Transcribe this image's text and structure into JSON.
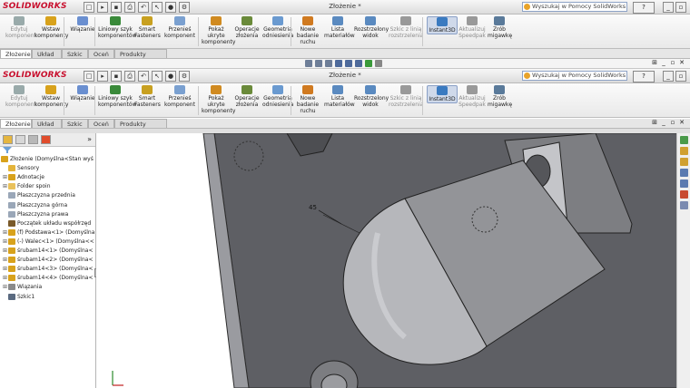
{
  "app": {
    "logo": "SOLIDWORKS",
    "document_title": "Złożenie *",
    "search_placeholder": "Wyszukaj w Pomocy SolidWorks",
    "help_label": "?"
  },
  "ribbon": {
    "buttons": [
      {
        "label": "Edytuj komponent",
        "icon": "edit-component-icon",
        "dim": true
      },
      {
        "label": "Wstaw komponenty",
        "icon": "insert-components-icon"
      },
      {
        "label": "Wiązanie",
        "icon": "mate-icon"
      },
      {
        "label": "Liniowy szyk komponentów",
        "icon": "linear-pattern-icon"
      },
      {
        "label": "Smart Fasteners",
        "icon": "smart-fasteners-icon"
      },
      {
        "label": "Przenieś komponent",
        "icon": "move-component-icon"
      },
      {
        "label": "Pokaż ukryte komponenty",
        "icon": "show-hidden-icon"
      },
      {
        "label": "Operacje złożenia",
        "icon": "assembly-features-icon"
      },
      {
        "label": "Geometria odniesienia",
        "icon": "reference-geometry-icon"
      },
      {
        "label": "Nowe badanie ruchu",
        "icon": "motion-study-icon"
      },
      {
        "label": "Lista materiałów",
        "icon": "bom-icon"
      },
      {
        "label": "Rozstrzelony widok",
        "icon": "exploded-view-icon"
      },
      {
        "label": "Szkic z linią rozstrzelenia",
        "icon": "explode-line-sketch-icon",
        "dim": true
      },
      {
        "label": "Instant3D",
        "icon": "instant3d-icon",
        "active": true
      },
      {
        "label": "Aktualizuj Speedpak",
        "icon": "speedpak-icon",
        "dim": true
      },
      {
        "label": "Zrób migawkę",
        "icon": "snapshot-icon"
      }
    ]
  },
  "tabs": [
    "Złożenie",
    "Układ",
    "Szkic",
    "Oceń",
    "Produkty Office"
  ],
  "tree": {
    "filter_icon": "funnel-icon",
    "items": [
      {
        "label": "Złożenie  (Domyślna<Stan wyś",
        "icon": "assembly-icon",
        "color": "#d8a21c"
      },
      {
        "label": "Sensory",
        "icon": "sensor-icon",
        "color": "#e4b43a"
      },
      {
        "label": "Adnotacje",
        "icon": "annotations-icon",
        "color": "#d8a21c",
        "plus": true
      },
      {
        "label": "Folder spoin",
        "icon": "weld-folder-icon",
        "color": "#e9c15b",
        "plus": true
      },
      {
        "label": "Płaszczyzna przednia",
        "icon": "plane-icon",
        "color": "#9aa7b8"
      },
      {
        "label": "Płaszczyzna górna",
        "icon": "plane-icon",
        "color": "#9aa7b8"
      },
      {
        "label": "Płaszczyzna prawa",
        "icon": "plane-icon",
        "color": "#9aa7b8"
      },
      {
        "label": "Początek układu współrzęd",
        "icon": "origin-icon",
        "color": "#7a5a2a"
      },
      {
        "label": "(f) Podstawa<1> (Domyślna",
        "icon": "part-icon",
        "color": "#d8a21c",
        "plus": true
      },
      {
        "label": "(-) Walec<1> (Domyślna<<",
        "icon": "part-icon",
        "color": "#d8a21c",
        "plus": true
      },
      {
        "label": "śrubam14<1> (Domyślna<",
        "icon": "part-icon",
        "color": "#d8a21c",
        "plus": true
      },
      {
        "label": "śrubam14<2> (Domyślna<",
        "icon": "part-icon",
        "color": "#d8a21c",
        "plus": true
      },
      {
        "label": "śrubam14<3> (Domyślna<",
        "icon": "part-icon",
        "color": "#d8a21c",
        "plus": true
      },
      {
        "label": "śrubam14<4> (Domyślna<",
        "icon": "part-icon",
        "color": "#d8a21c",
        "plus": true
      },
      {
        "label": "Wiązania",
        "icon": "mates-folder-icon",
        "color": "#8a8a8a",
        "plus": true
      },
      {
        "label": "Szkic1",
        "icon": "sketch-icon",
        "color": "#5a6a80"
      }
    ]
  },
  "viewport": {
    "dimension_label": "45"
  }
}
